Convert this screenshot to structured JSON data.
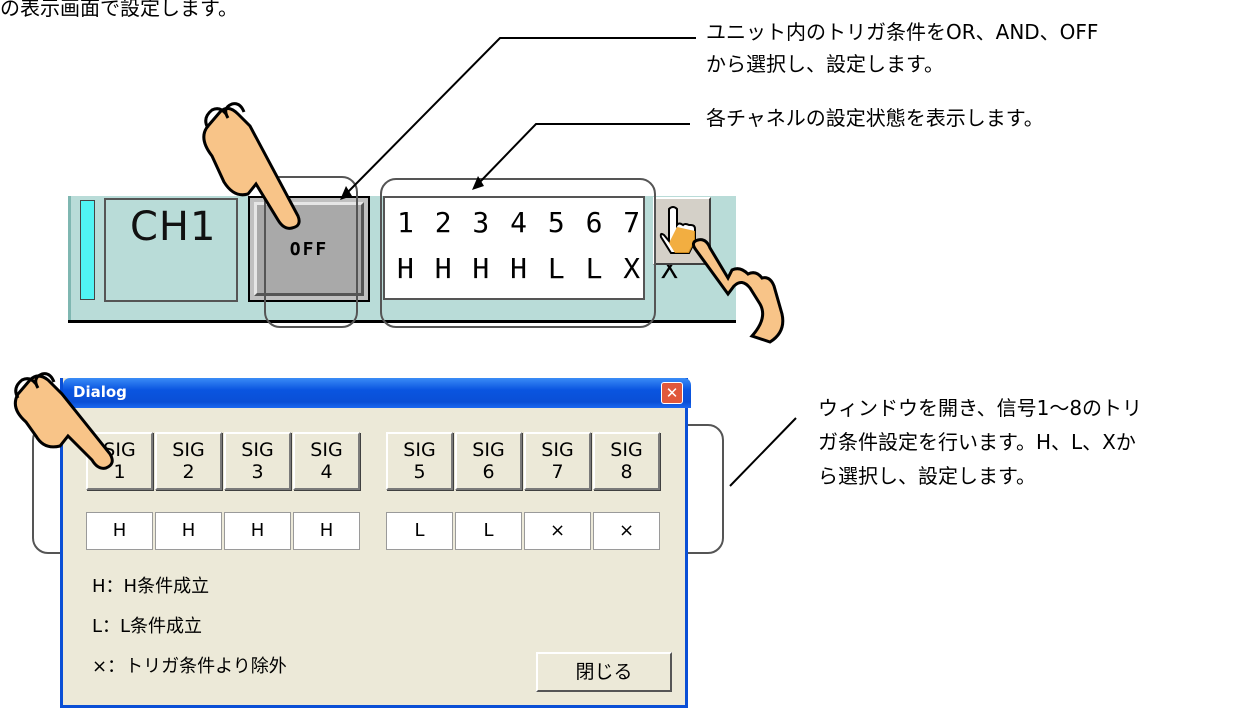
{
  "top_text_fragment": "の表示画面で設定します。",
  "notes": {
    "trigger_condition": [
      "ユニット内のトリガ条件をOR、AND、OFF",
      "から選択し、設定します。"
    ],
    "channel_state": "各チャネルの設定状態を表示します。",
    "window": [
      "ウィンドウを開き、信号1～8のトリ",
      "ガ条件設定を行います。H、L、Xか",
      "ら選択し、設定します。"
    ]
  },
  "channel": {
    "label": "CH1",
    "condition_button": "OFF",
    "channel_numbers": "1 2 3 4 5 6 7 8",
    "channel_states": "H H H H L L X X"
  },
  "dialog": {
    "title": "Dialog",
    "close_glyph": "✕",
    "signals": [
      {
        "line1": "SIG",
        "line2": "1",
        "value": "H"
      },
      {
        "line1": "SIG",
        "line2": "2",
        "value": "H"
      },
      {
        "line1": "SIG",
        "line2": "3",
        "value": "H"
      },
      {
        "line1": "SIG",
        "line2": "4",
        "value": "H"
      },
      {
        "line1": "SIG",
        "line2": "5",
        "value": "L"
      },
      {
        "line1": "SIG",
        "line2": "6",
        "value": "L"
      },
      {
        "line1": "SIG",
        "line2": "7",
        "value": "×"
      },
      {
        "line1": "SIG",
        "line2": "8",
        "value": "×"
      }
    ],
    "legend": [
      "H：H条件成立",
      "L：L条件成立",
      "×：トリガ条件より除外"
    ],
    "close_button": "閉じる"
  },
  "icons": [
    "pointing-hand-icon",
    "hand-cursor-icon",
    "close-icon"
  ],
  "colors": {
    "strip_bg": "#b9dcd8",
    "indicator_cyan": "#50f4f4",
    "titlebar_blue": "#0a4fd6",
    "dialog_bg": "#ece9d8",
    "hand_skin": "#f8c488"
  }
}
